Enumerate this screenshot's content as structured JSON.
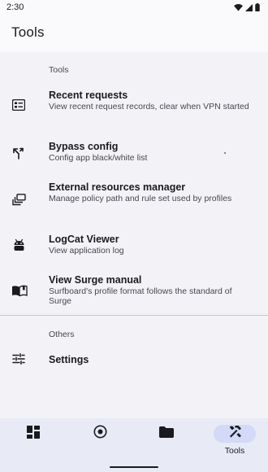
{
  "status_bar": {
    "time": "2:30",
    "icons": [
      "wifi-icon",
      "cellular-signal-icon",
      "battery-icon"
    ]
  },
  "app_bar": {
    "title": "Tools"
  },
  "sections": {
    "tools": {
      "header": "Tools",
      "items": [
        {
          "title": "Recent requests",
          "subtitle": "View recent request records, clear when VPN started",
          "icon": "list-icon"
        },
        {
          "title": "Bypass config",
          "subtitle": "Config app black/white list",
          "icon": "fork-arrows-icon"
        },
        {
          "title": "External resources manager",
          "subtitle": "Manage policy path and rule set used by profiles",
          "icon": "stack-icon"
        },
        {
          "title": "LogCat Viewer",
          "subtitle": "View application log",
          "icon": "android-icon"
        },
        {
          "title": "View Surge manual",
          "subtitle": "Surfboard's profile format follows the standard of Surge",
          "icon": "book-icon"
        }
      ]
    },
    "others": {
      "header": "Others",
      "items": [
        {
          "title": "Settings",
          "icon": "sliders-icon"
        }
      ]
    }
  },
  "bottom_nav": {
    "items": [
      {
        "label": "",
        "icon": "dashboard-icon"
      },
      {
        "label": "",
        "icon": "target-icon"
      },
      {
        "label": "",
        "icon": "folder-icon"
      },
      {
        "label": "Tools",
        "icon": "tools-icon",
        "active": true
      }
    ]
  }
}
